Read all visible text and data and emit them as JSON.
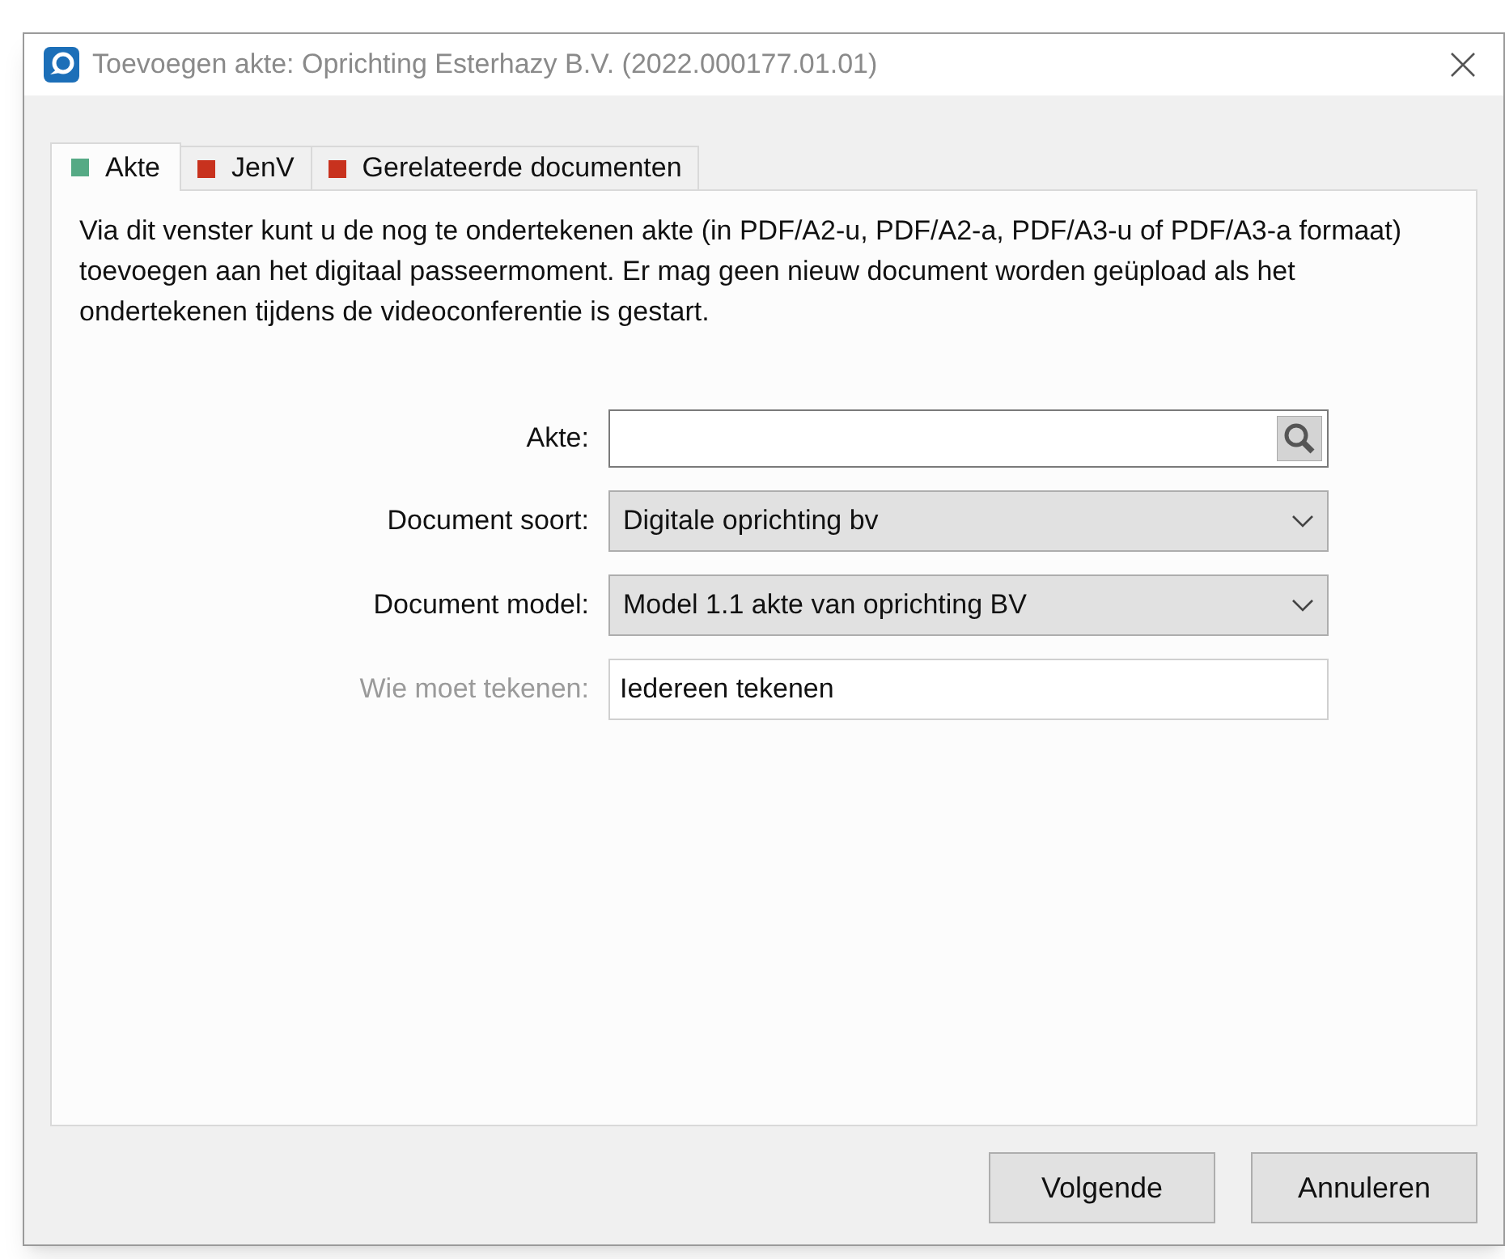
{
  "window": {
    "title": "Toevoegen akte: Oprichting Esterhazy B.V. (2022.000177.01.01)"
  },
  "tabs": [
    {
      "label": "Akte",
      "selected": true,
      "color": "#55aa85"
    },
    {
      "label": "JenV",
      "selected": false,
      "color": "#c8321e"
    },
    {
      "label": "Gerelateerde documenten",
      "selected": false,
      "color": "#c8321e"
    }
  ],
  "intro": "Via dit venster kunt u de nog te ondertekenen akte (in PDF/A2-u, PDF/A2-a, PDF/A3-u of PDF/A3-a formaat) toevoegen aan het digitaal passeermoment. Er mag geen nieuw document worden geüpload als het ondertekenen tijdens de videoconferentie is gestart.",
  "fields": [
    {
      "kind": "search",
      "label": "Akte:",
      "disabled": false
    },
    {
      "kind": "select",
      "label": "Document soort:",
      "value": "Digitale oprichting bv",
      "disabled": false
    },
    {
      "kind": "select",
      "label": "Document model:",
      "value": "Model 1.1 akte van oprichting BV",
      "disabled": false
    },
    {
      "kind": "text",
      "label": "Wie moet tekenen:",
      "value": "Iedereen tekenen",
      "disabled": true
    }
  ],
  "buttons": [
    "Volgende",
    "Annuleren"
  ]
}
